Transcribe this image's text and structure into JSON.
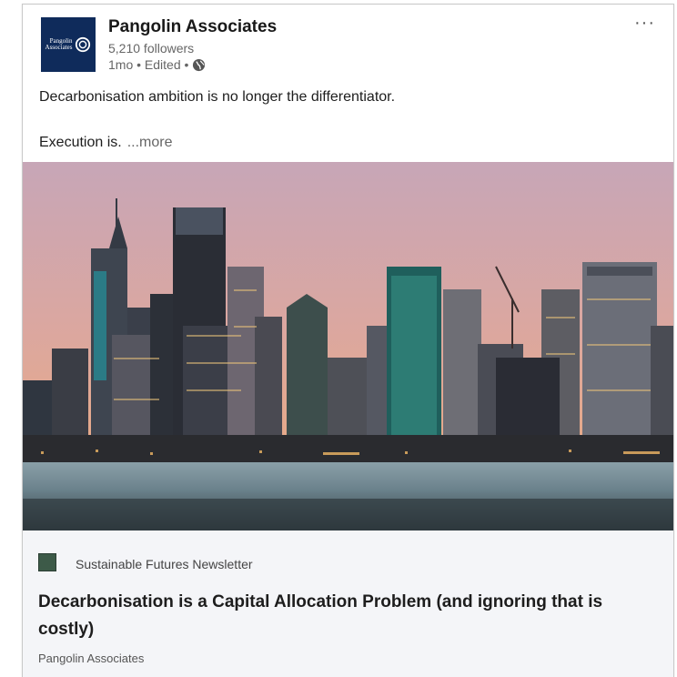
{
  "post": {
    "company": "Pangolin Associates",
    "followers": "5,210 followers",
    "meta": "1mo • Edited •",
    "logo_text_1": "Pangolin",
    "logo_text_2": "Associates",
    "more_icon": "more-dots-icon",
    "text_line1": "Decarbonisation ambition is no longer the differentiator.",
    "text_line2": "Execution is.",
    "more_label": "...more"
  },
  "image": {
    "description_icon": "city-skyline-image"
  },
  "article": {
    "newsletter": "Sustainable Futures Newsletter",
    "title": "Decarbonisation is a Capital Allocation Problem (and ignoring that is costly)",
    "author": "Pangolin Associates"
  },
  "colors": {
    "logo_bg": "#0f2b5b",
    "footer_bg": "#f4f5f8",
    "sky_top": "#c9a3b4",
    "sky_bottom": "#e4a78b",
    "water": "#6f8893"
  }
}
